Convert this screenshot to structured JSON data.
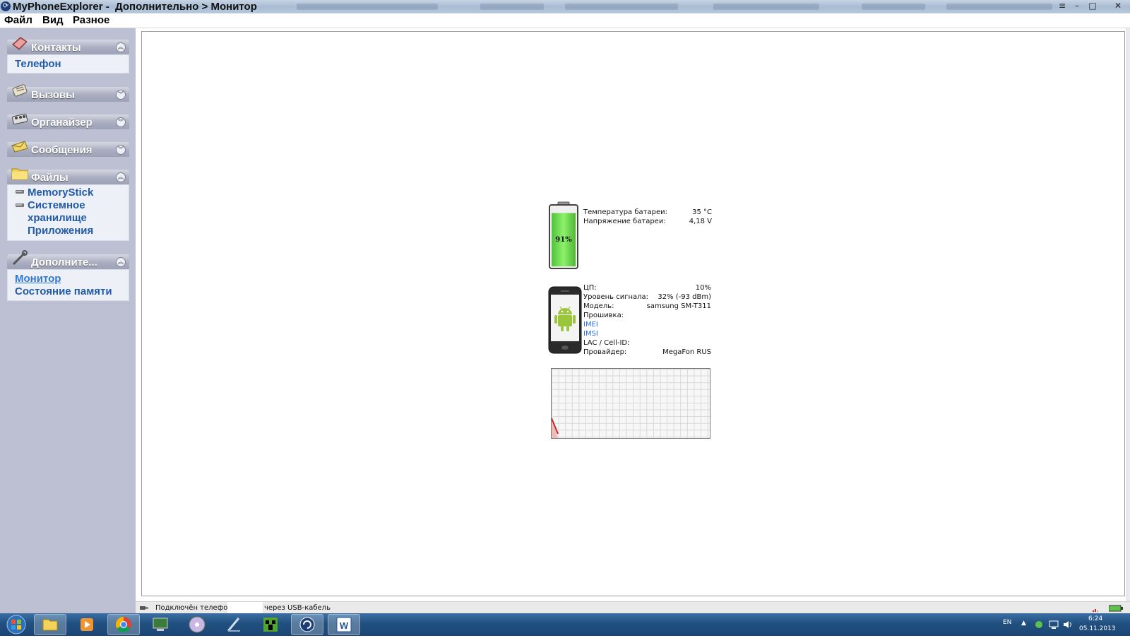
{
  "window": {
    "title": "MyPhoneExplorer -  Дополнительно > Монитор",
    "controls": {
      "minimize": "–",
      "maximize": "□",
      "close": "✕"
    }
  },
  "menu": [
    "Файл",
    "Вид",
    "Разное"
  ],
  "sidebar": {
    "panels": [
      {
        "title": "Контакты",
        "icon": "contacts-book-icon",
        "expanded": true,
        "items": [
          "Телефон"
        ]
      },
      {
        "title": "Вызовы",
        "icon": "calls-icon",
        "expanded": false,
        "items": []
      },
      {
        "title": "Органайзер",
        "icon": "organizer-icon",
        "expanded": false,
        "items": []
      },
      {
        "title": "Сообщения",
        "icon": "messages-envelope-icon",
        "expanded": false,
        "items": []
      },
      {
        "title": "Файлы",
        "icon": "folder-icon",
        "expanded": true,
        "items": [
          "MemoryStick",
          "Системное",
          "хранилище",
          "Приложения"
        ]
      },
      {
        "title": "Дополните...",
        "icon": "tools-icon",
        "expanded": true,
        "items": [
          "Монитор",
          "Состояние памяти"
        ],
        "selected": "Монитор"
      }
    ]
  },
  "monitor": {
    "battery": {
      "level_text": "91%",
      "level_fraction": 0.91,
      "rows": [
        {
          "label": "Температура батареи:",
          "value": "35 °C"
        },
        {
          "label": "Напряжение батареи:",
          "value": "4,18 V"
        }
      ]
    },
    "device": {
      "rows": [
        {
          "label": "ЦП:",
          "value": "10%"
        },
        {
          "label": "Уровень сигнала:",
          "value": "32% (-93 dBm)"
        },
        {
          "label": "Модель:",
          "value": "samsung SM-T311"
        },
        {
          "label": "Прошивка:",
          "value": ""
        },
        {
          "label": "IMEI",
          "value": "",
          "link": true
        },
        {
          "label": "IMSI",
          "value": "",
          "link": true
        },
        {
          "label": "LAC / Cell-ID:",
          "value": ""
        },
        {
          "label": "Провайдер:",
          "value": "MegaFon RUS"
        }
      ]
    },
    "cpu_graph": {
      "line_color": "#c0282d",
      "fill_color": "#f2b8b8"
    }
  },
  "statusbar": {
    "text_left": "Подключён телефон",
    "text_right": "через USB-кабель"
  },
  "taskbar": {
    "apps": [
      "start-orb-icon",
      "explorer-folder-icon",
      "media-player-icon",
      "chrome-icon",
      "network-icon",
      "dvd-icon",
      "pen-tool-icon",
      "minecraft-icon",
      "myphoneexplorer-icon",
      "word-icon"
    ],
    "tray": {
      "lang": "EN",
      "time": "6:24",
      "date": "05.11.2013"
    }
  }
}
